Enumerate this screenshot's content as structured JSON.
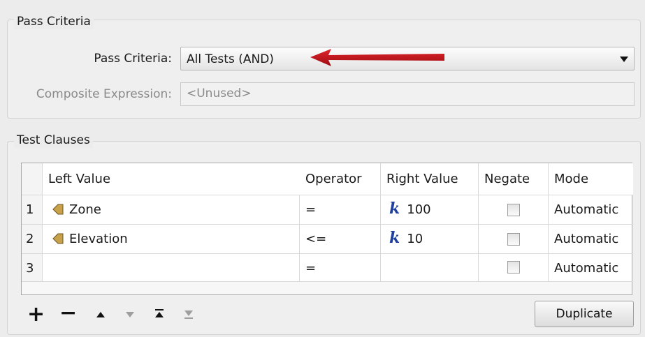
{
  "pass_group": {
    "title": "Pass Criteria",
    "pass_label": "Pass Criteria:",
    "pass_value": "All Tests (AND)",
    "composite_label": "Composite Expression:",
    "composite_value": "<Unused>"
  },
  "clauses_group": {
    "title": "Test Clauses",
    "columns": [
      "Left Value",
      "Operator",
      "Right Value",
      "Negate",
      "Mode"
    ],
    "rows": [
      {
        "num": "1",
        "left": "Zone",
        "left_icon": "attribute-icon",
        "operator": "=",
        "right": "100",
        "right_icon": "constant-k-icon",
        "negate": false,
        "mode": "Automatic"
      },
      {
        "num": "2",
        "left": "Elevation",
        "left_icon": "attribute-icon",
        "operator": "<=",
        "right": "10",
        "right_icon": "constant-k-icon",
        "negate": false,
        "mode": "Automatic"
      },
      {
        "num": "3",
        "left": "",
        "operator": "=",
        "right": "",
        "negate": false,
        "mode": "Automatic"
      }
    ]
  },
  "toolbar": {
    "add_icon": "+",
    "remove_icon": "−",
    "duplicate_label": "Duplicate"
  },
  "colors": {
    "annotation_arrow": "#c0141b",
    "constant_k": "#1e3f9e",
    "attribute_icon": "#c8a24a"
  }
}
